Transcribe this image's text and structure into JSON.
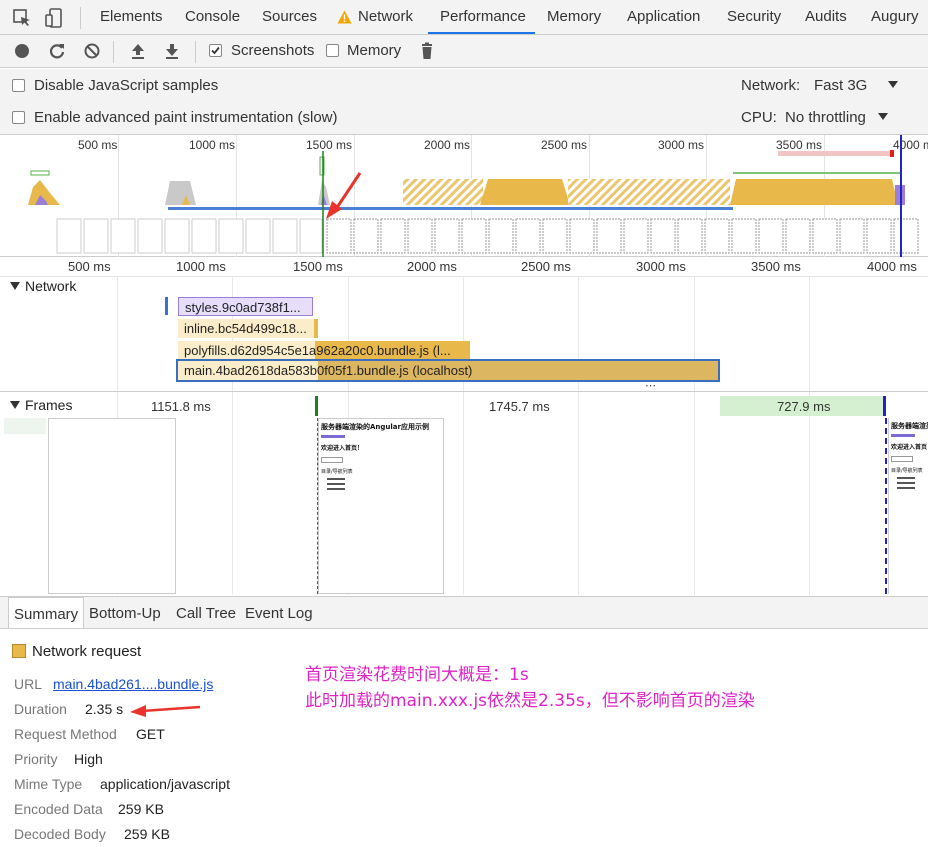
{
  "tabs": [
    {
      "label": "Elements"
    },
    {
      "label": "Console"
    },
    {
      "label": "Sources"
    },
    {
      "label": "Network"
    },
    {
      "label": "Performance"
    },
    {
      "label": "Memory"
    },
    {
      "label": "Application"
    },
    {
      "label": "Security"
    },
    {
      "label": "Audits"
    },
    {
      "label": "Augury"
    }
  ],
  "toolbar": {
    "screenshots_label": "Screenshots",
    "screenshots_checked": true,
    "memory_label": "Memory",
    "memory_checked": false
  },
  "settings": {
    "disable_js_label": "Disable JavaScript samples",
    "advanced_paint_label": "Enable advanced paint instrumentation (slow)",
    "network_label": "Network:",
    "network_value": "Fast 3G",
    "cpu_label": "CPU:",
    "cpu_value": "No throttling"
  },
  "overview": {
    "ticks": [
      "500 ms",
      "1000 ms",
      "1500 ms",
      "2000 ms",
      "2500 ms",
      "3000 ms",
      "3500 ms",
      "4000 ms"
    ]
  },
  "ruler": {
    "ticks": [
      "500 ms",
      "1000 ms",
      "1500 ms",
      "2000 ms",
      "2500 ms",
      "3000 ms",
      "3500 ms",
      "4000 ms"
    ]
  },
  "network": {
    "title": "Network",
    "requests": [
      {
        "label": "styles.9c0ad738f1..."
      },
      {
        "label": "inline.bc54d499c18..."
      },
      {
        "label": "polyfills.d62d954c5e1a962a20c0.bundle.js (l..."
      },
      {
        "label": "main.4bad2618da583b0f05f1.bundle.js (localhost)"
      }
    ]
  },
  "frames": {
    "title": "Frames",
    "times": [
      "1151.8 ms",
      "1745.7 ms",
      "727.9 ms"
    ],
    "screenshot_title": "服务器端渲染的Angular应用示例",
    "screenshot_heading": "欢迎进入首页！",
    "screenshot_list_title": "目录/导航列表"
  },
  "bottom_tabs": [
    {
      "label": "Summary"
    },
    {
      "label": "Bottom-Up"
    },
    {
      "label": "Call Tree"
    },
    {
      "label": "Event Log"
    }
  ],
  "summary": {
    "category": "Network request",
    "category_color": "#e8b84b",
    "url_key": "URL",
    "url_value": "main.4bad261....bundle.js",
    "duration_key": "Duration",
    "duration_value": "2.35 s",
    "method_key": "Request Method",
    "method_value": "GET",
    "priority_key": "Priority",
    "priority_value": "High",
    "mime_key": "Mime Type",
    "mime_value": "application/javascript",
    "encoded_key": "Encoded Data",
    "encoded_value": "259 KB",
    "decoded_key": "Decoded Body",
    "decoded_value": "259 KB"
  },
  "annotation": {
    "line1": "首页渲染花费时间大概是：1s",
    "line2": "此时加载的main.xxx.js依然是2.35s，但不影响首页的渲染",
    "color": "#e023c8"
  },
  "colors": {
    "accent": "#1a73e8",
    "script": "#e8b84b",
    "css": "#c9b8f0",
    "arrow": "#e8342a",
    "frame_green": "#d5f0d0"
  }
}
